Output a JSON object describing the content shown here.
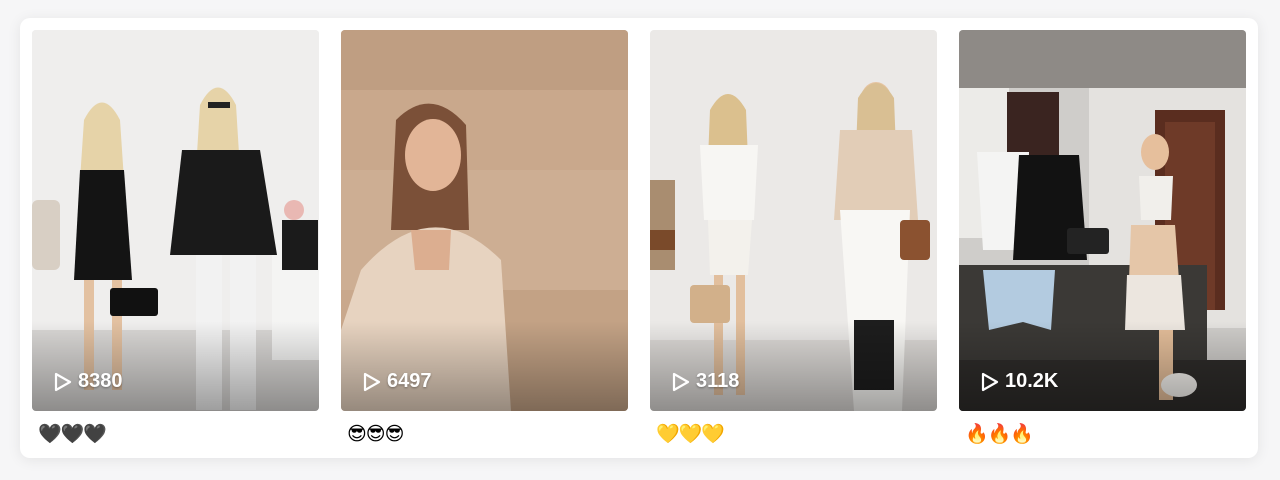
{
  "videos": [
    {
      "views": "8380",
      "caption": "🖤🖤🖤"
    },
    {
      "views": "6497",
      "caption": "😎😎😎"
    },
    {
      "views": "3118",
      "caption": "💛💛💛"
    },
    {
      "views": "10.2K",
      "caption": "🔥🔥🔥"
    }
  ],
  "icons": {
    "play": "play-icon"
  }
}
